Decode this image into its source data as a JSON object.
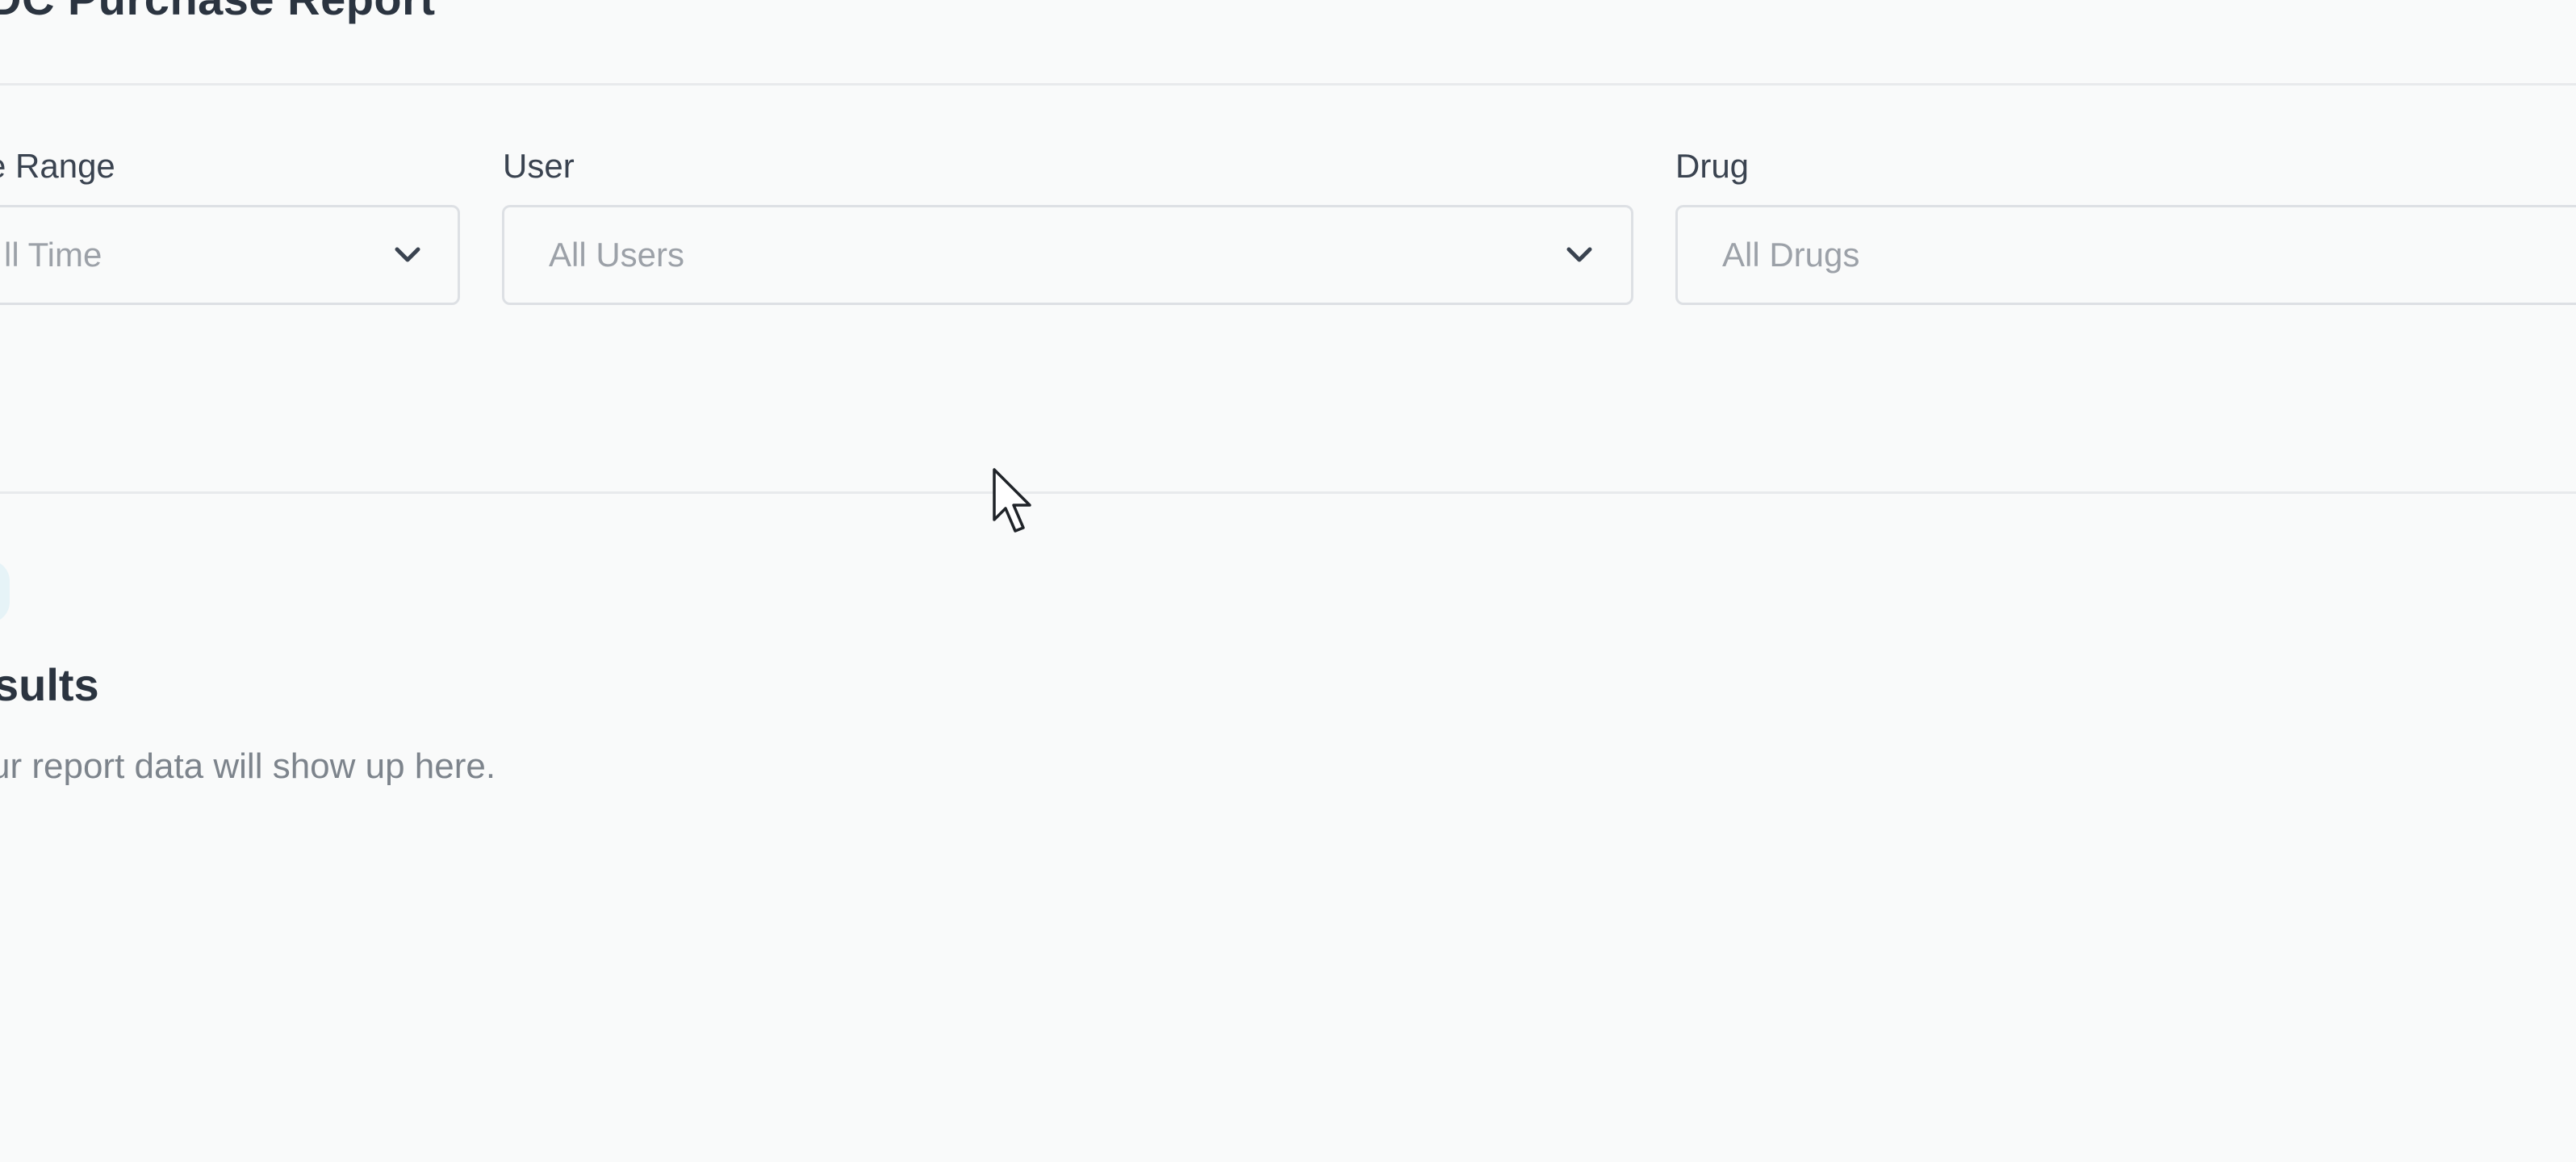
{
  "page": {
    "title": "DC Purchase Report"
  },
  "filters": {
    "date_range": {
      "label": "e Range",
      "value": "ll Time",
      "icon": "chevron-down-icon"
    },
    "user": {
      "label": "User",
      "value": "All Users",
      "icon": "chevron-down-icon"
    },
    "drug": {
      "label": "Drug",
      "placeholder": "All Drugs"
    }
  },
  "empty_state": {
    "icon": "report-icon",
    "title": "sults",
    "message": "ur report data will show up here."
  },
  "colors": {
    "background": "#f9fafa",
    "text": "#2b3440",
    "muted": "#9ca1a8",
    "border": "#dde0e4",
    "accent": "#1a7c99"
  }
}
